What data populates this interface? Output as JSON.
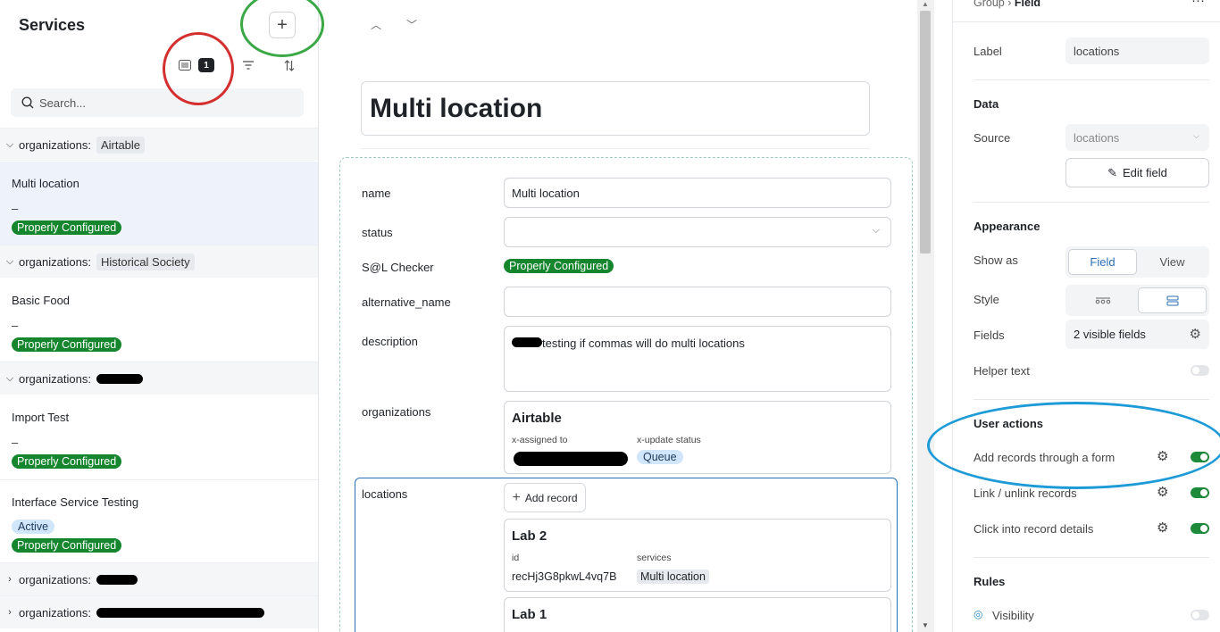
{
  "sidebar": {
    "title": "Services",
    "filter_count": "1",
    "search_placeholder": "Search...",
    "group_label": "organizations:",
    "groups": [
      {
        "value": "Airtable"
      },
      {
        "value": "Historical Society"
      },
      {
        "value": ""
      },
      {
        "value": ""
      },
      {
        "value": ""
      }
    ],
    "records": [
      {
        "name": "Multi location",
        "dash": "–",
        "badges": [
          "Properly Configured"
        ]
      },
      {
        "name": "Basic Food",
        "dash": "–",
        "badges": [
          "Properly Configured"
        ]
      },
      {
        "name": "Import Test",
        "dash": "–",
        "badges": [
          "Properly Configured"
        ]
      },
      {
        "name": "Interface Service Testing",
        "status": "Active",
        "badges": [
          "Properly Configured"
        ]
      }
    ]
  },
  "main": {
    "title": "Multi location",
    "fields": {
      "name": {
        "label": "name",
        "value": "Multi location"
      },
      "status": {
        "label": "status",
        "value": ""
      },
      "checker": {
        "label": "S@L Checker",
        "value": "Properly Configured"
      },
      "alt": {
        "label": "alternative_name",
        "value": ""
      },
      "desc": {
        "label": "description",
        "value": "testing if commas will do multi locations"
      },
      "orgs": {
        "label": "organizations"
      },
      "locs": {
        "label": "locations"
      }
    },
    "org_card": {
      "title": "Airtable",
      "assigned_label": "x-assigned to",
      "update_label": "x-update status",
      "update_value": "Queue"
    },
    "add_record": "Add record",
    "locations": [
      {
        "title": "Lab 2",
        "id_label": "id",
        "id_value": "recHj3G8pkwL4vq7B",
        "services_label": "services",
        "services_value": "Multi location"
      },
      {
        "title": "Lab 1"
      }
    ]
  },
  "props": {
    "breadcrumb_group": "Group",
    "breadcrumb_sep": "›",
    "breadcrumb_current": "Field",
    "more": "···",
    "label_label": "Label",
    "label_value": "locations",
    "data_heading": "Data",
    "source_label": "Source",
    "source_value": "locations",
    "edit_field": "Edit field",
    "appearance_heading": "Appearance",
    "show_as_label": "Show as",
    "show_as_options": [
      "Field",
      "View"
    ],
    "show_as_selected": "Field",
    "style_label": "Style",
    "fields_label": "Fields",
    "fields_value": "2 visible fields",
    "helper_label": "Helper text",
    "helper_on": false,
    "user_actions_heading": "User actions",
    "actions": [
      {
        "label": "Add records through a form",
        "on": true
      },
      {
        "label": "Link / unlink records",
        "on": true
      },
      {
        "label": "Click into record details",
        "on": true
      }
    ],
    "rules_heading": "Rules",
    "visibility_label": "Visibility",
    "visibility_on": false
  },
  "colors": {
    "accent_blue": "#2a6fb5",
    "badge_green": "#16862e",
    "annotation_red": "#d32f2f",
    "annotation_green": "#3aa845",
    "annotation_blue": "#1e9bd7"
  },
  "icons": [
    "plus-icon",
    "list-icon",
    "filter-icon",
    "sort-icon",
    "search-icon",
    "chevron-down-icon",
    "chevron-right-icon",
    "chevron-up-icon",
    "pencil-icon",
    "gear-icon",
    "more-icon"
  ]
}
